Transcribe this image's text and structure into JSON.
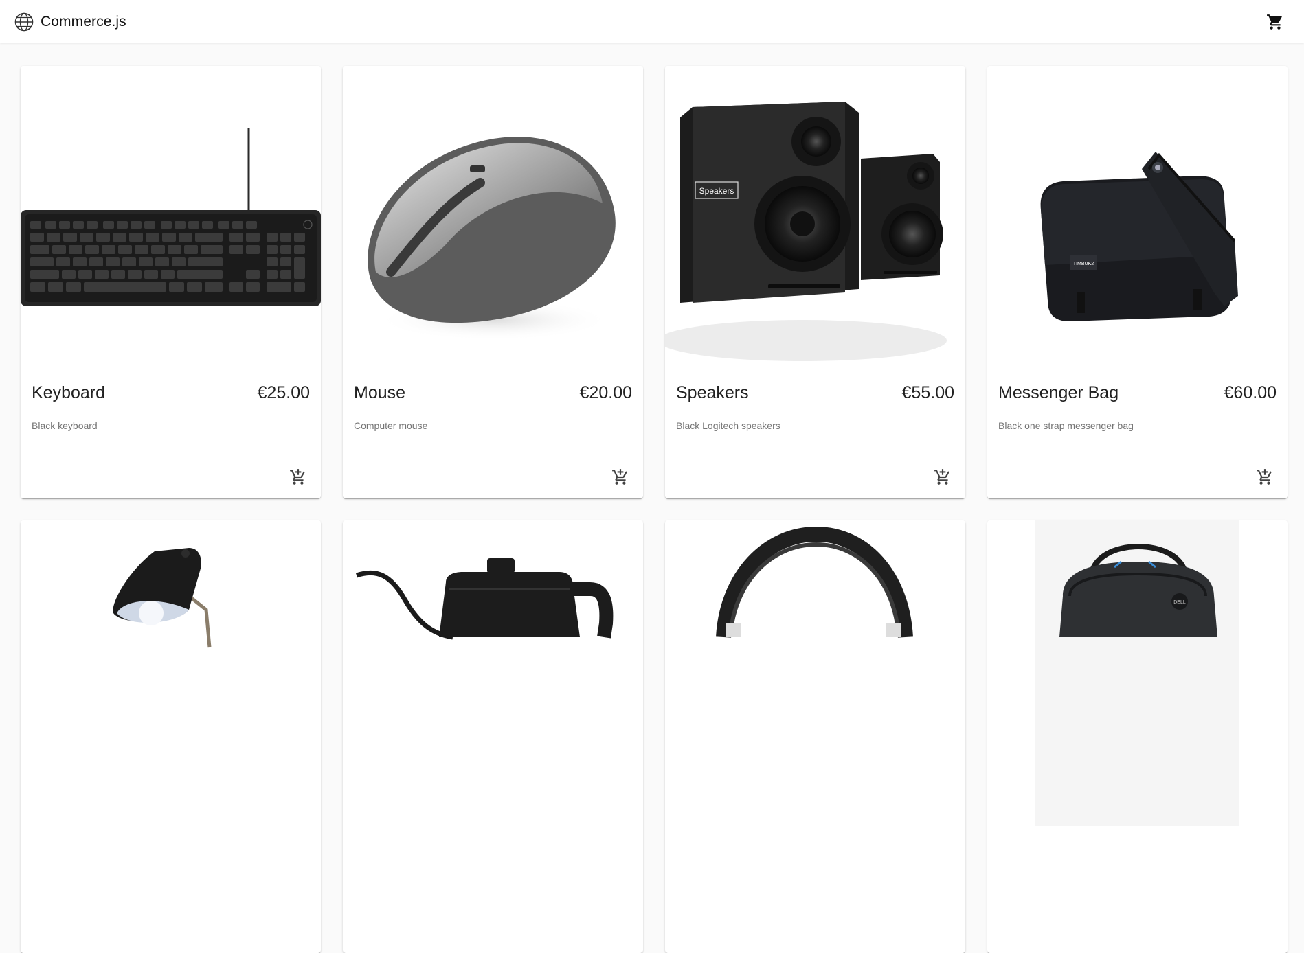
{
  "header": {
    "logo_icon": "globe-icon",
    "title": "Commerce.js",
    "cart_icon": "shopping-cart-icon"
  },
  "products": [
    {
      "name": "Keyboard",
      "price": "€25.00",
      "description": "Black keyboard",
      "image": "keyboard-photo"
    },
    {
      "name": "Mouse",
      "price": "€20.00",
      "description": "Computer mouse",
      "image": "mouse-photo"
    },
    {
      "name": "Speakers",
      "price": "€55.00",
      "description": "Black Logitech speakers",
      "image": "speakers-photo",
      "image_label": "Speakers"
    },
    {
      "name": "Messenger Bag",
      "price": "€60.00",
      "description": "Black one strap messenger bag",
      "image": "messenger-bag-photo",
      "image_label": "TIMBUK2"
    },
    {
      "image": "desk-lamp-photo"
    },
    {
      "image": "kettle-photo"
    },
    {
      "image": "headphones-photo"
    },
    {
      "image": "backpack-photo",
      "image_label": "DELL"
    }
  ],
  "add_to_cart_icon": "add-shopping-cart-icon",
  "colors": {
    "appbar": "#ffffff",
    "background": "#fafafa",
    "text": "#212121",
    "muted": "#757575"
  }
}
